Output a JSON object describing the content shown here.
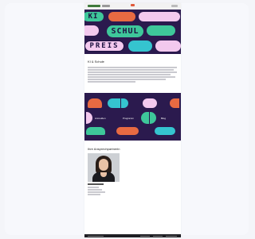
{
  "hero": {
    "word_top": "KI",
    "word_middle": "SCHUL",
    "word_bottom": "PREIS"
  },
  "intro": {
    "title": "KI & Schule"
  },
  "band": {
    "labels": [
      "Anmelden",
      "Programm",
      "Blog"
    ]
  },
  "team": {
    "title": "Ihre Ansprechpartnerin"
  },
  "colors": {
    "brand_purple": "#2b1a4e",
    "green": "#3ec79a",
    "orange": "#e86a42",
    "pink": "#f3c9ee",
    "cyan": "#35c4cf"
  }
}
